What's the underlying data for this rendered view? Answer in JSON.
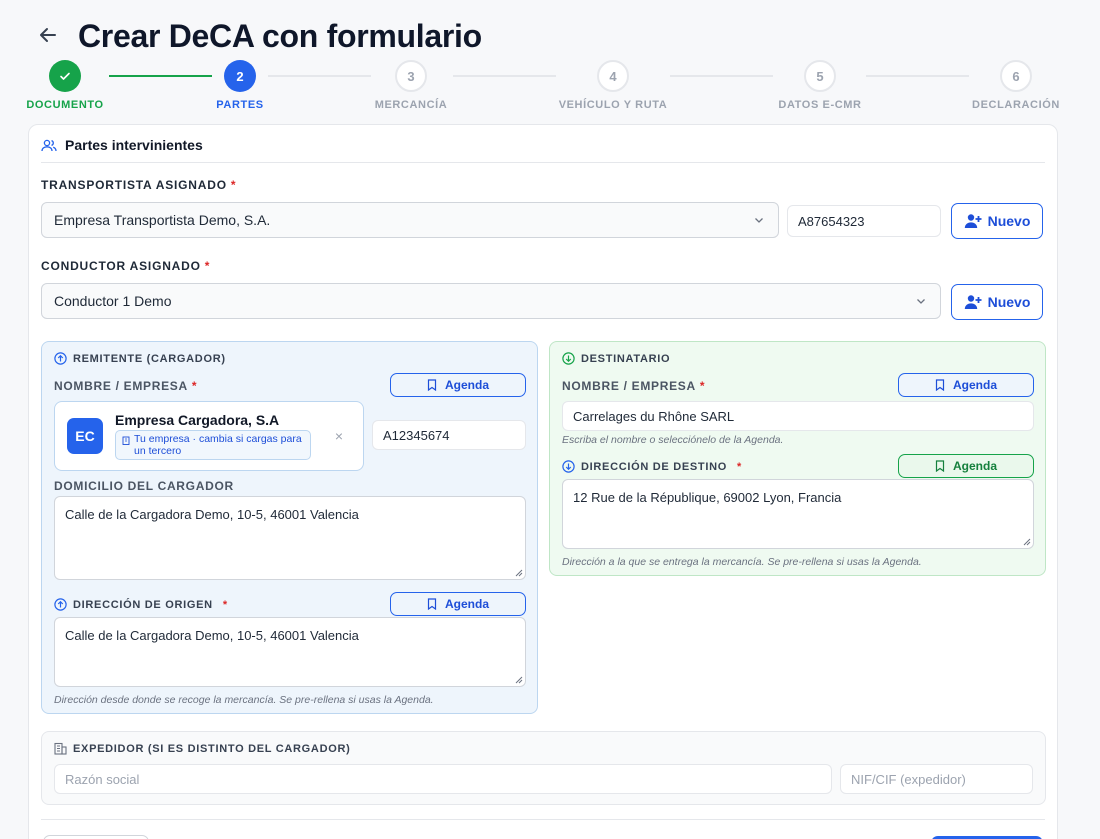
{
  "header": {
    "title": "Crear DeCA con formulario"
  },
  "stepper": {
    "steps": [
      {
        "number": "1",
        "label": "DOCUMENTO",
        "state": "done"
      },
      {
        "number": "2",
        "label": "PARTES",
        "state": "active"
      },
      {
        "number": "3",
        "label": "MERCANCÍA",
        "state": "todo"
      },
      {
        "number": "4",
        "label": "VEHÍCULO Y RUTA",
        "state": "todo"
      },
      {
        "number": "5",
        "label": "DATOS E-CMR",
        "state": "todo"
      },
      {
        "number": "6",
        "label": "DECLARACIÓN",
        "state": "todo"
      }
    ]
  },
  "card": {
    "title": "Partes intervinientes"
  },
  "transportista": {
    "label": "TRANSPORTISTA ASIGNADO",
    "required": "*",
    "selected": "Empresa Transportista Demo, S.A.",
    "nif": "A87654323",
    "new_label": "Nuevo"
  },
  "conductor": {
    "label": "CONDUCTOR ASIGNADO",
    "required": "*",
    "selected": "Conductor 1 Demo",
    "new_label": "Nuevo"
  },
  "remitente": {
    "title": "REMITENTE (CARGADOR)",
    "name_label": "NOMBRE / EMPRESA",
    "required": "*",
    "agenda_label": "Agenda",
    "avatar": "EC",
    "company_name": "Empresa Cargadora, S.A",
    "company_tag": "Tu empresa · cambia si cargas para un tercero",
    "remove": "×",
    "nif": "A12345674",
    "domicilio_label": "DOMICILIO DEL CARGADOR",
    "domicilio_value": "Calle de la Cargadora Demo, 10-5, 46001 Valencia",
    "origen_label": "DIRECCIÓN DE ORIGEN",
    "origen_agenda_label": "Agenda",
    "origen_value": "Calle de la Cargadora Demo, 10-5, 46001 Valencia",
    "origen_hint": "Dirección desde donde se recoge la mercancía. Se pre-rellena si usas la Agenda."
  },
  "destinatario": {
    "title": "DESTINATARIO",
    "name_label": "NOMBRE / EMPRESA",
    "required": "*",
    "agenda_label": "Agenda",
    "name_value": "Carrelages du Rhône SARL",
    "name_hint": "Escriba el nombre o selecciónelo de la Agenda.",
    "destino_label": "DIRECCIÓN DE DESTINO",
    "destino_agenda_label": "Agenda",
    "destino_value": "12 Rue de la République, 69002 Lyon, Francia",
    "destino_hint": "Dirección a la que se entrega la mercancía. Se pre-rellena si usas la Agenda."
  },
  "expedidor": {
    "title": "EXPEDIDOR (SI ES DISTINTO DEL CARGADOR)",
    "razon_placeholder": "Razón social",
    "nif_placeholder": "NIF/CIF (expedidor)"
  },
  "colors": {
    "primary": "#2563eb",
    "success": "#16a34a",
    "danger": "#dc2626"
  }
}
